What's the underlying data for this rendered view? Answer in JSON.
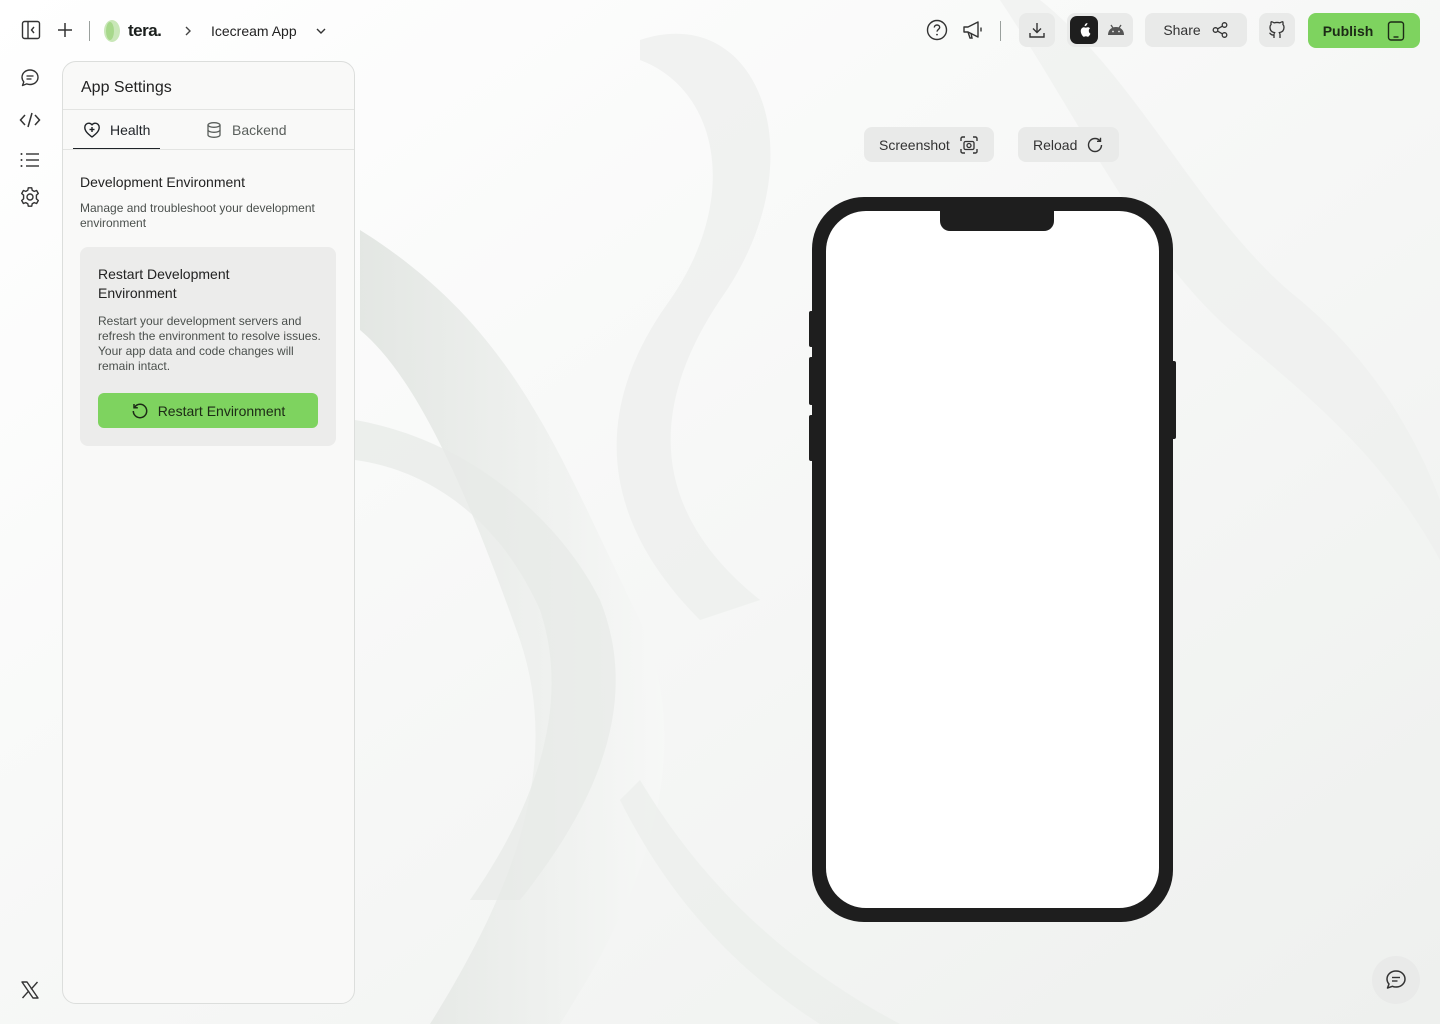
{
  "header": {
    "brand": "tera.",
    "breadcrumb_separator": "›",
    "project_name": "Icecream App",
    "share_label": "Share",
    "publish_label": "Publish"
  },
  "sidebar": {
    "icons": [
      "panel-toggle-icon",
      "plus-icon",
      "chat-icon",
      "code-icon",
      "list-icon",
      "settings-icon",
      "x-logo-icon"
    ]
  },
  "panel": {
    "title": "App Settings",
    "tabs": [
      {
        "label": "Health",
        "icon": "health-icon",
        "active": true
      },
      {
        "label": "Backend",
        "icon": "database-icon",
        "active": false
      }
    ],
    "section_title": "Development Environment",
    "section_desc": "Manage and troubleshoot your development environment",
    "card": {
      "title": "Restart Development Environment",
      "desc": "Restart your development servers and refresh the environment to resolve issues. Your app data and code changes will remain intact.",
      "button_label": "Restart Environment"
    }
  },
  "preview": {
    "screenshot_label": "Screenshot",
    "reload_label": "Reload",
    "platform_selected": "ios"
  },
  "colors": {
    "accent": "#7ed35f",
    "phone_frame": "#1e1e1e"
  }
}
